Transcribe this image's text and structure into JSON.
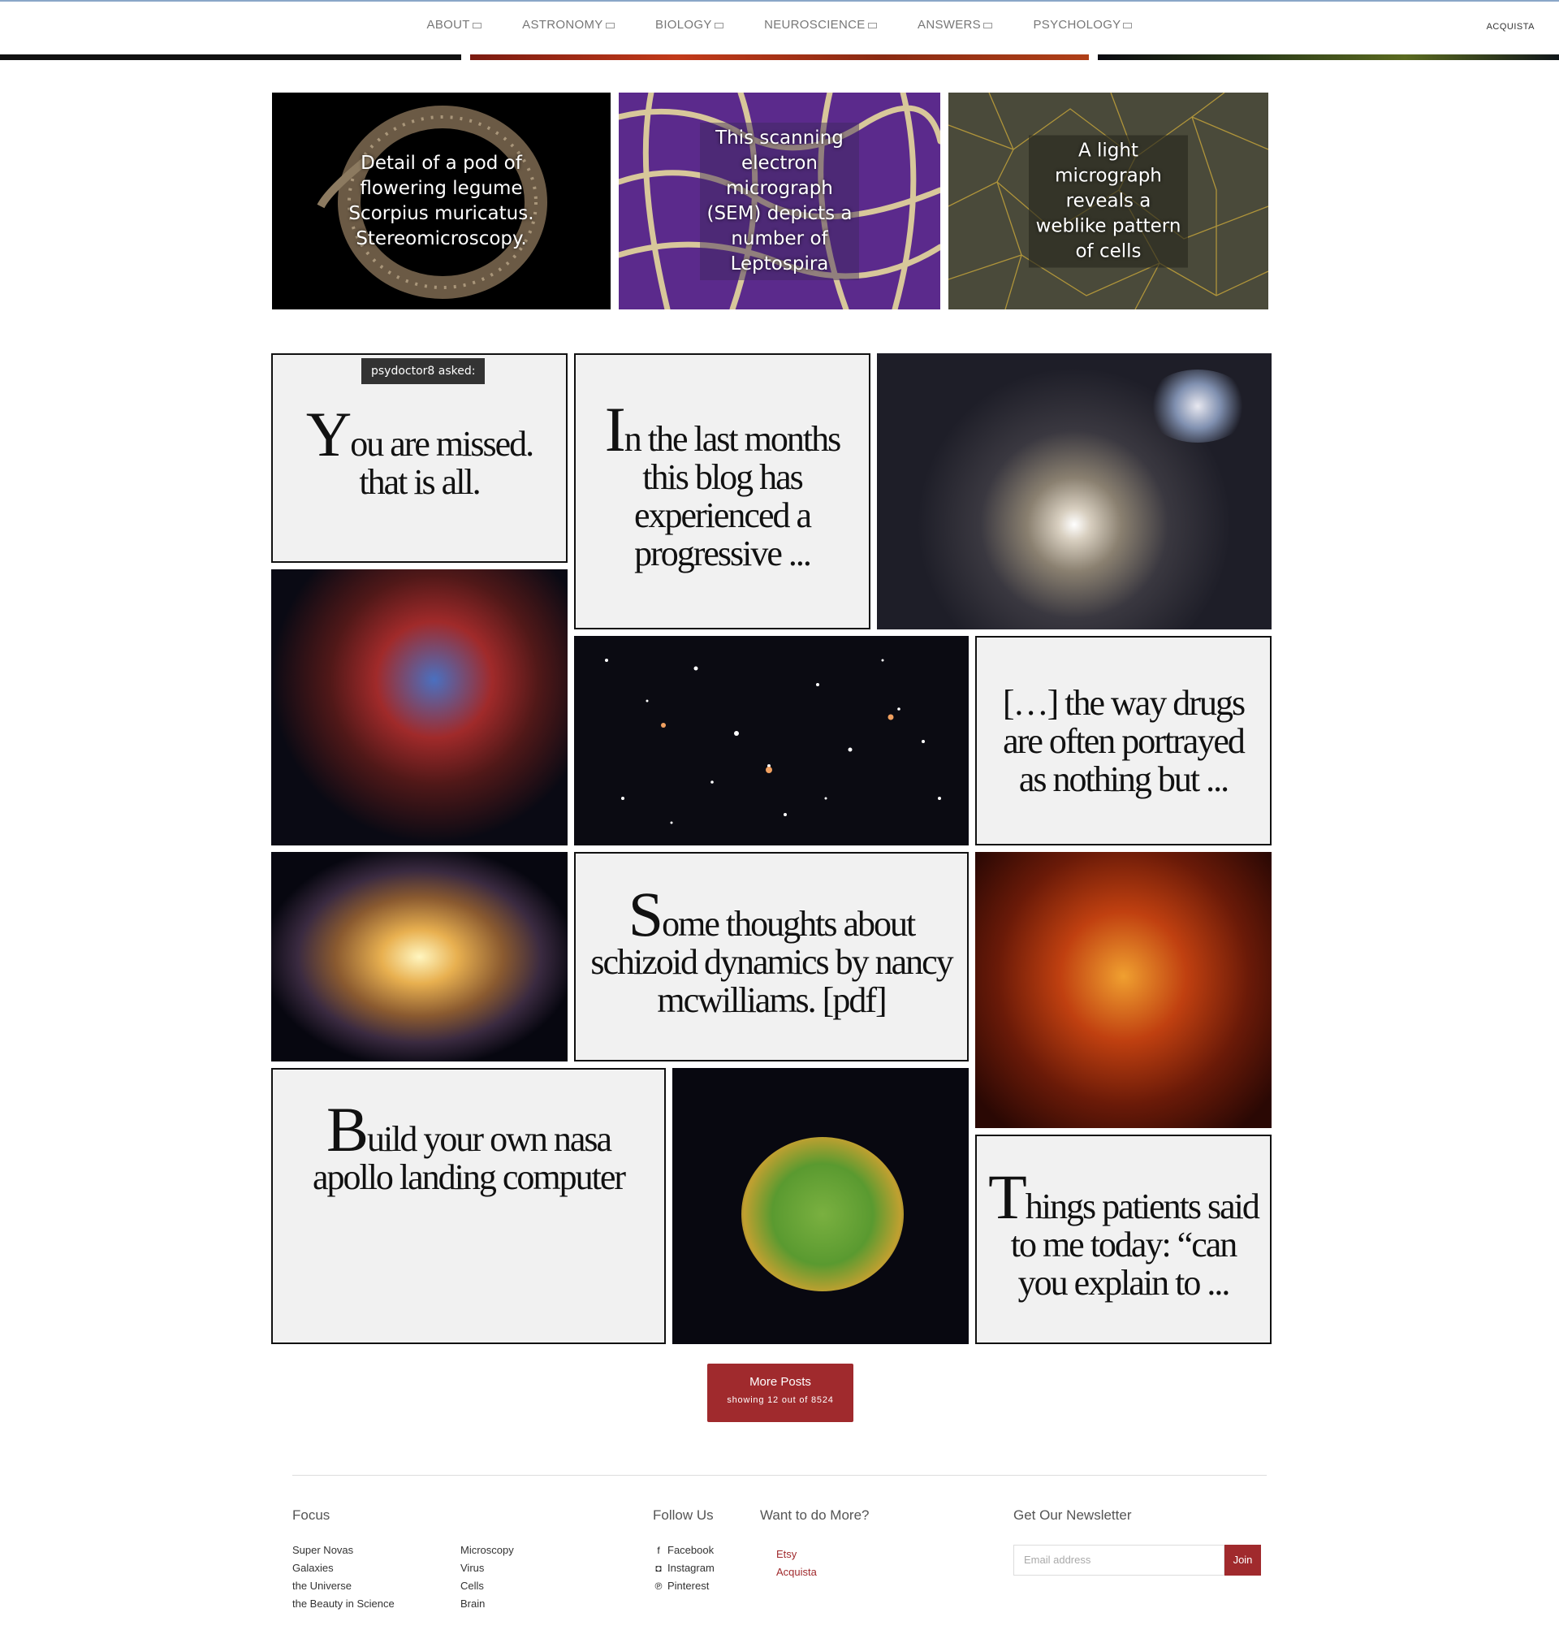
{
  "nav": {
    "items": [
      "ABOUT",
      "ASTRONOMY",
      "BIOLOGY",
      "NEUROSCIENCE",
      "ANSWERS",
      "PSYCHOLOGY"
    ],
    "brand": "ACQUISTA"
  },
  "featured": [
    {
      "caption": "Detail of a pod of flowering legume Scorpius muricatus. Stereomicroscopy."
    },
    {
      "caption": "This scanning electron micrograph (SEM) depicts a number of Leptospira"
    },
    {
      "caption": "A light micrograph reveals a weblike pattern of cells"
    }
  ],
  "posts": {
    "asker": "psydoctor8  asked:",
    "ask_initial": "Y",
    "ask_rest": "ou are missed. that is all.",
    "p1_initial": "I",
    "p1_rest": "n the last months this blog has experienced a progressive ...",
    "p2_text": "[…] the way drugs are often portrayed as nothing but ...",
    "p3_initial": "S",
    "p3_rest": "ome thoughts about schizoid dynamics by nancy mcwilliams. [pdf]",
    "p4_initial": "B",
    "p4_rest": "uild your own nasa apollo landing computer",
    "p5_initial": "T",
    "p5_rest": "hings patients said to me today: “can you explain to ..."
  },
  "more": {
    "label": "More Posts",
    "sub": "showing 12 out of 8524"
  },
  "footer": {
    "focus_title": "Focus",
    "focus_col1": [
      "Super Novas",
      "Galaxies",
      "the Universe",
      "the Beauty in Science"
    ],
    "focus_col2": [
      "Microscopy",
      "Virus",
      "Cells",
      "Brain"
    ],
    "follow_title": "Follow Us",
    "follow": [
      "Facebook",
      "Instagram",
      "Pinterest"
    ],
    "more_title": "Want to do More?",
    "more_links": [
      "Etsy",
      "Acquista"
    ],
    "newsletter_title": "Get Our Newsletter",
    "email_placeholder": "Email address",
    "join_label": "Join"
  }
}
